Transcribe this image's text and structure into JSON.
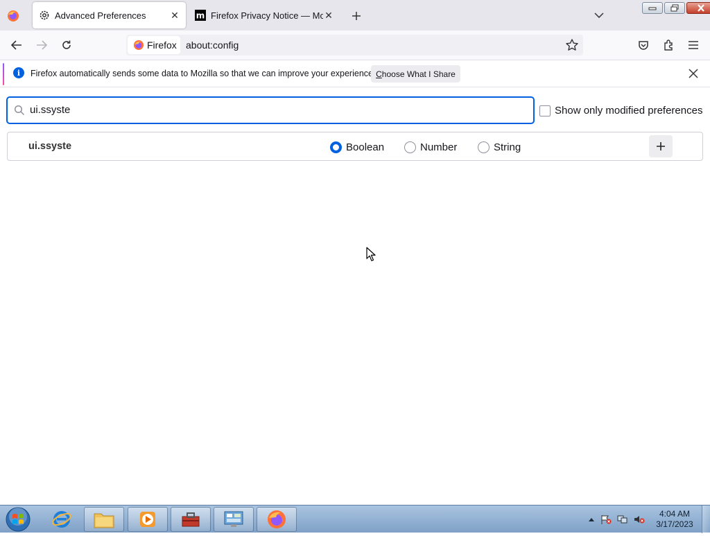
{
  "tabs": [
    {
      "title": "Advanced Preferences",
      "icon": "gear-icon",
      "active": true
    },
    {
      "title": "Firefox Privacy Notice — Mozilla",
      "icon": "mozilla-m-icon",
      "active": false
    }
  ],
  "navbar": {
    "identity_label": "Firefox",
    "url": "about:config"
  },
  "notification": {
    "message": "Firefox automatically sends some data to Mozilla so that we can improve your experience.",
    "button_prefix": "",
    "button_underlined": "C",
    "button_rest": "hoose What I Share"
  },
  "config": {
    "search_value": "ui.ssyste",
    "show_modified_label": "Show only modified preferences",
    "show_modified_checked": false,
    "new_pref_name": "ui.ssyste",
    "types": [
      {
        "label": "Boolean",
        "selected": true
      },
      {
        "label": "Number",
        "selected": false
      },
      {
        "label": "String",
        "selected": false
      }
    ],
    "add_button_symbol": "+"
  },
  "taskbar": {
    "time": "4:04 AM",
    "date": "3/17/2023"
  },
  "colors": {
    "accent": "#0061e0",
    "tabstrip_bg": "#e6e6ec",
    "taskbar_bg": "#a9c4e0"
  }
}
